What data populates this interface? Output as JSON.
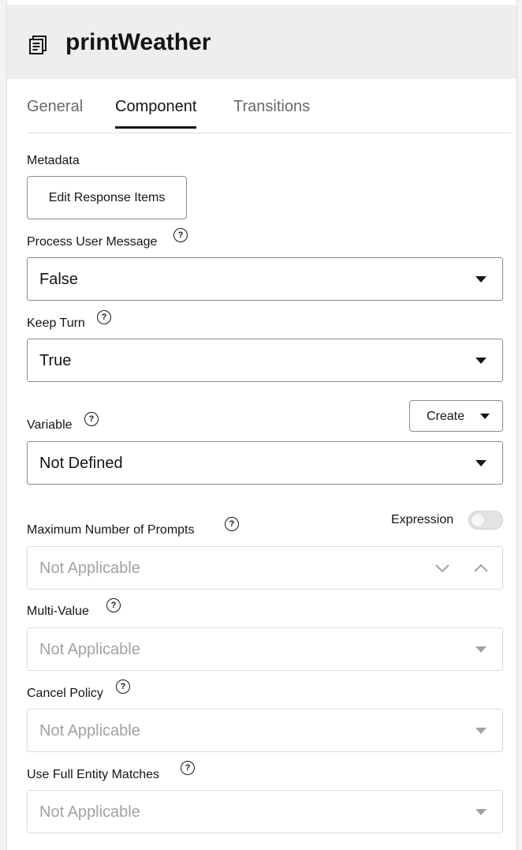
{
  "header": {
    "title": "printWeather",
    "icon": "component-icon"
  },
  "tabs": [
    {
      "label": "General",
      "active": false
    },
    {
      "label": "Component",
      "active": true
    },
    {
      "label": "Transitions",
      "active": false
    }
  ],
  "metadata": {
    "label": "Metadata",
    "edit_button": "Edit Response Items"
  },
  "process_user_message": {
    "label": "Process User Message",
    "value": "False"
  },
  "keep_turn": {
    "label": "Keep Turn",
    "value": "True"
  },
  "variable": {
    "label": "Variable",
    "value": "Not Defined",
    "create_button": "Create"
  },
  "max_prompts": {
    "label": "Maximum Number of Prompts",
    "value": "Not Applicable",
    "expression_label": "Expression",
    "expression_on": false
  },
  "multi_value": {
    "label": "Multi-Value",
    "value": "Not Applicable"
  },
  "cancel_policy": {
    "label": "Cancel Policy",
    "value": "Not Applicable"
  },
  "full_entity": {
    "label": "Use Full Entity Matches",
    "value": "Not Applicable"
  },
  "help_glyph": "?",
  "colors": {
    "header_bg": "#efeeec",
    "text": "#161513",
    "muted": "#a3a2a0",
    "border": "#8d8c8a"
  }
}
